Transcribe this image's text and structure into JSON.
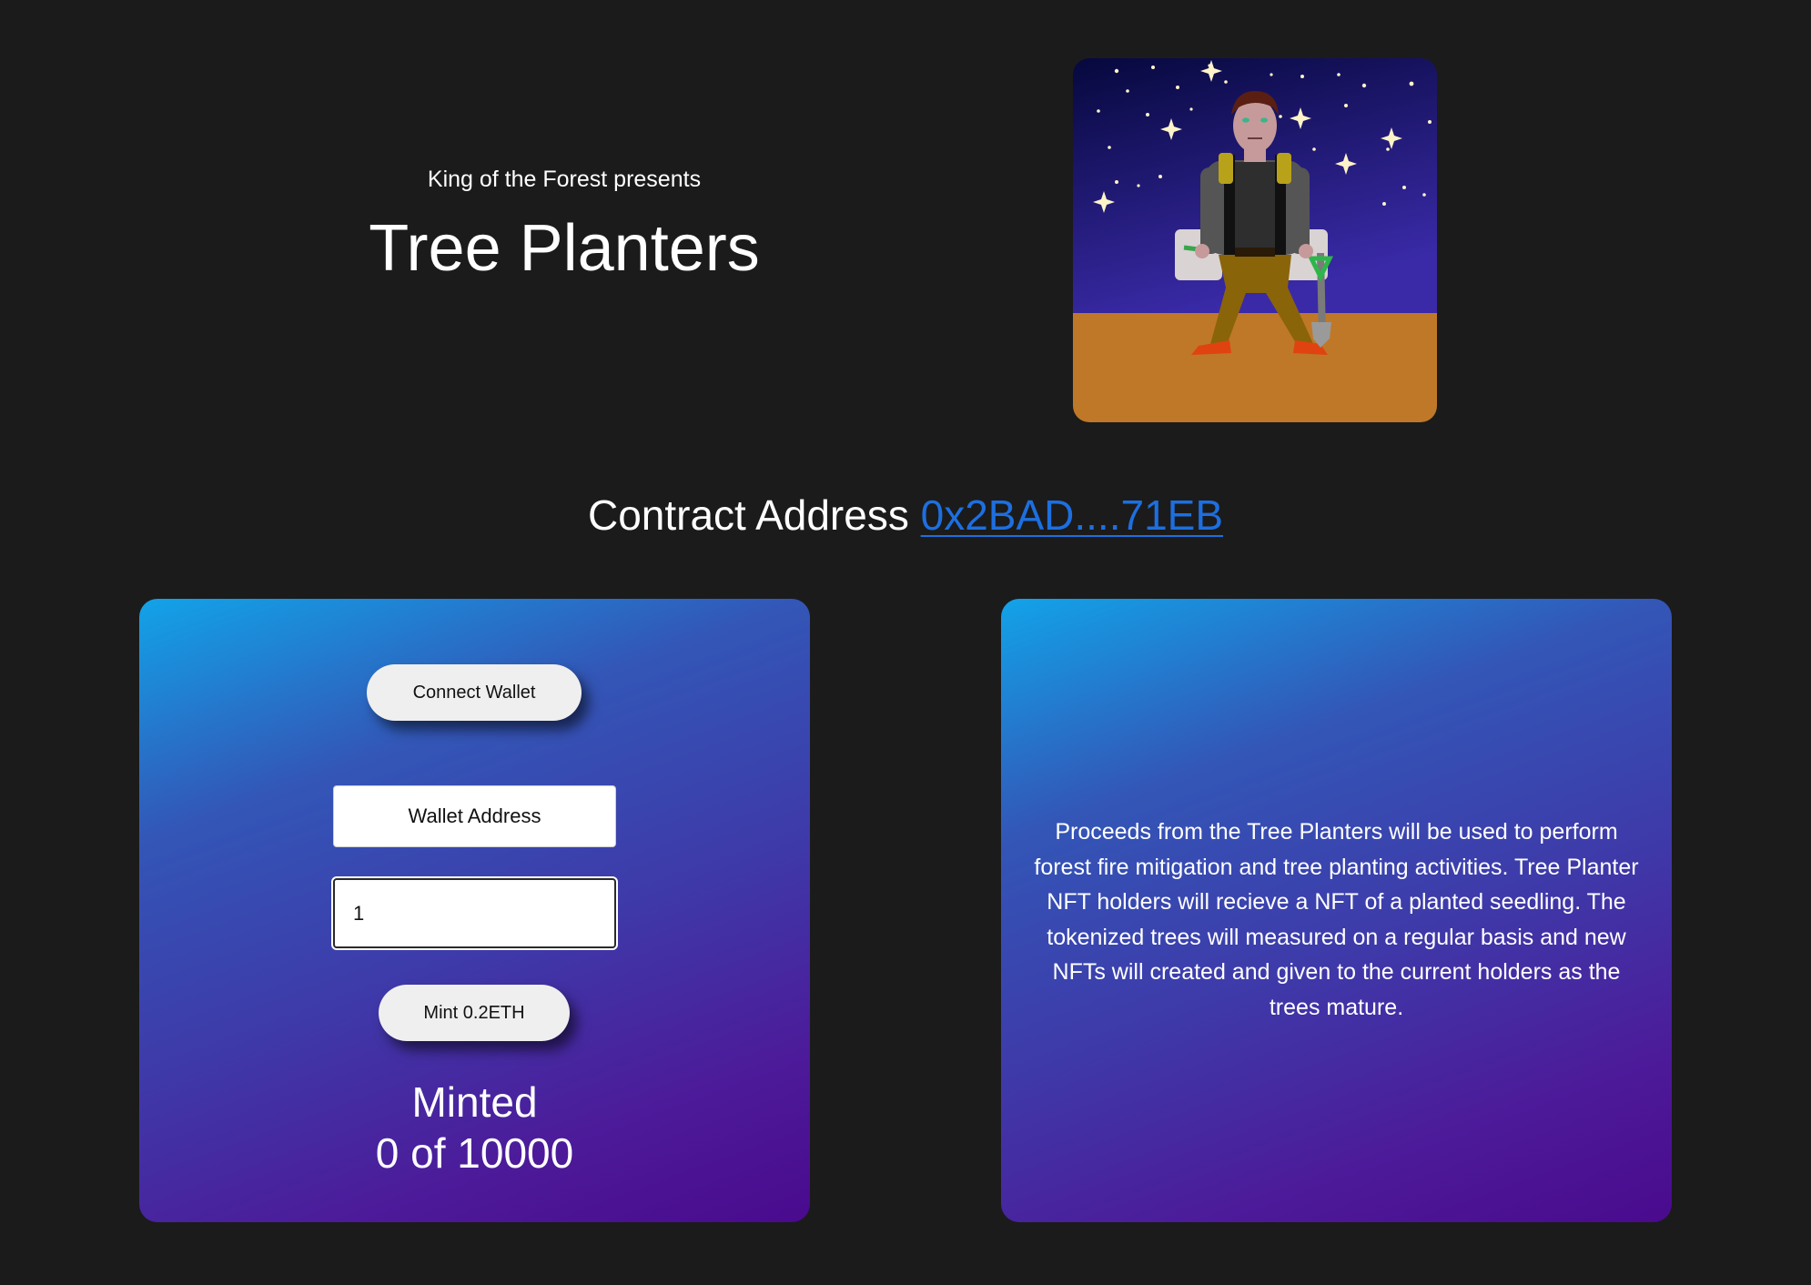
{
  "hero": {
    "presents": "King of the Forest presents",
    "title": "Tree Planters"
  },
  "artwork": {
    "icon": "tree-planter-character-illustration",
    "colors": {
      "sky_top": "#06083d",
      "sky_bottom": "#3a2aa8",
      "ground": "#bf7828",
      "stars": "#fff4c8"
    }
  },
  "contract": {
    "label": "Contract Address",
    "address_short": "0x2BAD....71EB"
  },
  "mint_card": {
    "connect_label": "Connect Wallet",
    "wallet_placeholder": "Wallet Address",
    "quantity_value": "1",
    "mint_label": "Mint 0.2ETH",
    "minted_label": "Minted",
    "minted_count": "0 of 10000"
  },
  "info_card": {
    "text": "Proceeds from the Tree Planters will be used to perform forest fire mitigation and tree planting activities. Tree Planter NFT holders will recieve a NFT of a planted seedling. The tokenized trees will measured on a regular basis and new NFTs will created and given to the current holders as the trees mature."
  },
  "theme": {
    "background": "#1b1b1b",
    "link": "#1d6fe0",
    "card_gradient_start": "#12a3e8",
    "card_gradient_end": "#4a0a8e"
  }
}
